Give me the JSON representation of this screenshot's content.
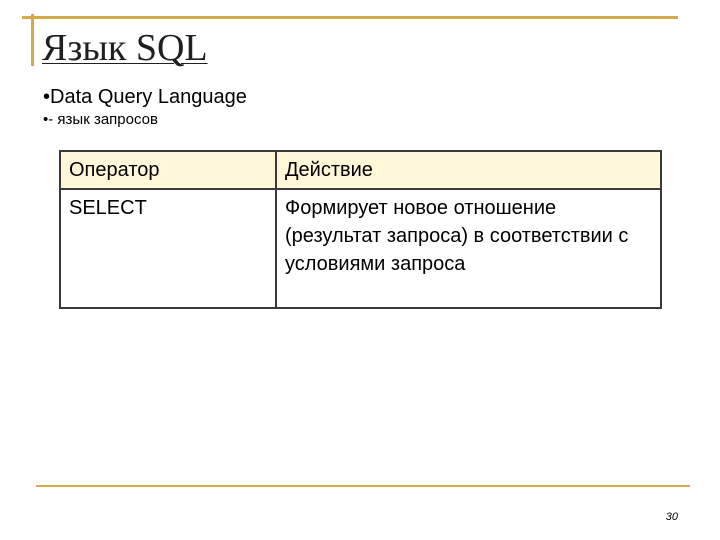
{
  "slide": {
    "title": "Язык SQL",
    "bullets": [
      "Data Query Language",
      "- язык запросов"
    ],
    "bullet_symbol": "•",
    "accent_color": "#d4a94a",
    "table": {
      "header": [
        "Оператор",
        "Действие"
      ],
      "rows": [
        [
          "SELECT",
          "Формирует новое отношение (результат запроса) в соответствии с условиями запроса"
        ]
      ],
      "header_bg": "#fff7d8"
    },
    "page_number": "30"
  }
}
